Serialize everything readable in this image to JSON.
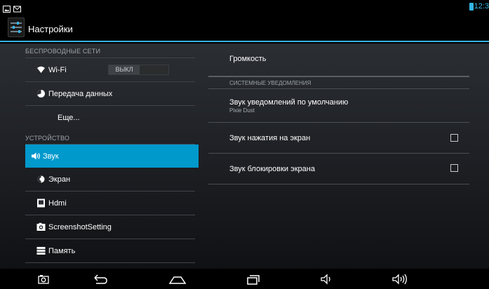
{
  "app": {
    "title": "Настройки"
  },
  "status_bar": {
    "time": "12:3",
    "icons": [
      "picture-icon",
      "mail-icon"
    ],
    "battery_color": "#33b5e5"
  },
  "accent_color": "#33b5e5",
  "selection_color": "#0099cc",
  "sidebar": {
    "sections": [
      {
        "header": "БЕСПРОВОДНЫЕ СЕТИ",
        "items": [
          {
            "label": "Wi-Fi",
            "icon": "wifi-icon",
            "toggle": "ВЫКЛ"
          },
          {
            "label": "Передача данных",
            "icon": "data-usage-icon"
          },
          {
            "label": "Еще...",
            "icon": ""
          }
        ]
      },
      {
        "header": "УСТРОЙСТВО",
        "items": [
          {
            "label": "Звук",
            "icon": "sound-icon",
            "selected": true
          },
          {
            "label": "Экран",
            "icon": "display-icon"
          },
          {
            "label": "Hdmi",
            "icon": "hdmi-icon"
          },
          {
            "label": "ScreenshotSetting",
            "icon": "screenshot-icon"
          },
          {
            "label": "Память",
            "icon": "storage-icon"
          }
        ]
      }
    ]
  },
  "detail": {
    "volume_label": "Громкость",
    "system_notifications_header": "СИСТЕМНЫЕ УВЕДОМЛЕНИЯ",
    "default_notification": {
      "title": "Звук уведомлений по умолчанию",
      "value": "Pixie Dust"
    },
    "touch_sounds": {
      "label": "Звук нажатия на экран",
      "checked": false
    },
    "lock_sounds": {
      "label": "Звук блокировки экрана",
      "checked": false
    }
  },
  "nav_bar": {
    "buttons": [
      "screenshot-button",
      "back-button",
      "home-button",
      "recent-apps-button",
      "volume-down-button",
      "volume-up-button"
    ]
  }
}
